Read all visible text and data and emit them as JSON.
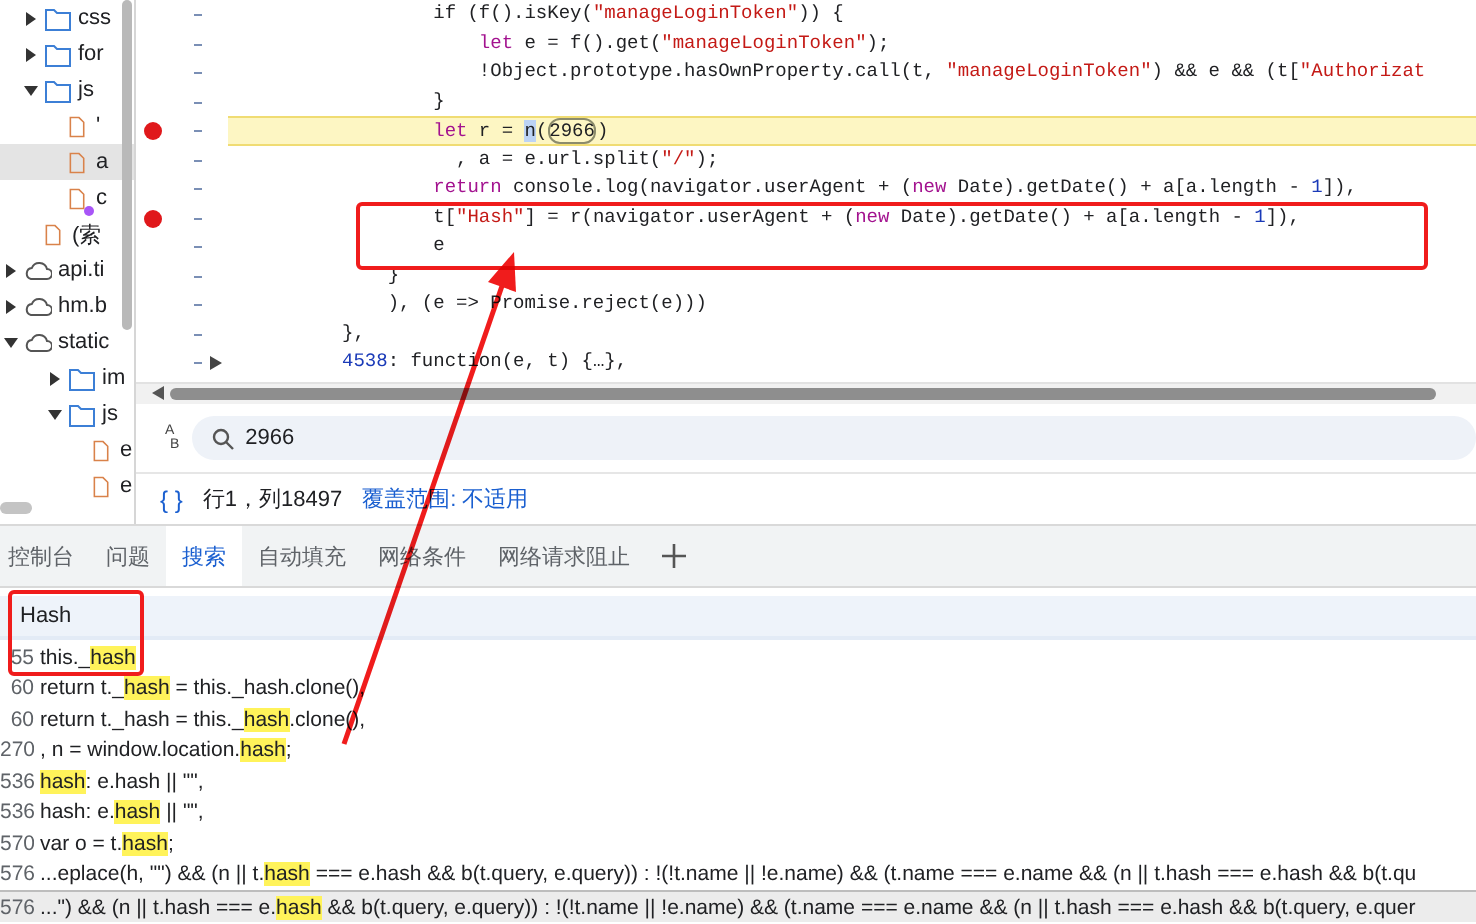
{
  "file_tree": [
    {
      "kind": "folder",
      "label": "css",
      "expanded": false,
      "selected": false
    },
    {
      "kind": "folder",
      "label": "for",
      "expanded": false,
      "selected": false
    },
    {
      "kind": "folder",
      "label": "js",
      "expanded": true,
      "selected": false,
      "children": [
        {
          "kind": "file",
          "label": "'",
          "selected": false,
          "has_dot": false
        },
        {
          "kind": "file",
          "label": "a",
          "selected": true,
          "has_dot": false
        },
        {
          "kind": "file",
          "label": "c",
          "selected": false,
          "has_dot": true
        }
      ]
    },
    {
      "kind": "file",
      "label": "(索",
      "selected": false,
      "has_dot": false
    },
    {
      "kind": "domain",
      "label": "api.ti",
      "expanded": false,
      "selected": false
    },
    {
      "kind": "domain",
      "label": "hm.b",
      "expanded": false,
      "selected": false
    },
    {
      "kind": "domain",
      "label": "static",
      "expanded": true,
      "selected": false,
      "children": [
        {
          "kind": "folder",
          "label": "im",
          "expanded": false,
          "selected": false
        },
        {
          "kind": "folder",
          "label": "js",
          "expanded": true,
          "selected": false,
          "children": [
            {
              "kind": "file",
              "label": "e",
              "selected": false,
              "has_dot": false
            },
            {
              "kind": "file",
              "label": "e",
              "selected": false,
              "has_dot": false
            }
          ]
        }
      ]
    }
  ],
  "code_lines": [
    {
      "breakpoint": false,
      "paused": false,
      "expandable": false,
      "tokens": [
        {
          "kind": "plain",
          "text": "                  if (f().isKey("
        },
        {
          "kind": "str",
          "text": "\"manageLoginToken\""
        },
        {
          "kind": "plain",
          "text": ")) {"
        }
      ]
    },
    {
      "breakpoint": false,
      "paused": false,
      "expandable": false,
      "tokens": [
        {
          "kind": "kw",
          "text": "                      let"
        },
        {
          "kind": "plain",
          "text": " e = f().get("
        },
        {
          "kind": "str",
          "text": "\"manageLoginToken\""
        },
        {
          "kind": "plain",
          "text": ");"
        }
      ]
    },
    {
      "breakpoint": false,
      "paused": false,
      "expandable": false,
      "tokens": [
        {
          "kind": "plain",
          "text": "                      !Object.prototype.hasOwnProperty.call(t, "
        },
        {
          "kind": "str",
          "text": "\"manageLoginToken\""
        },
        {
          "kind": "plain",
          "text": ") && e && (t["
        },
        {
          "kind": "str",
          "text": "\"Authorizat"
        }
      ]
    },
    {
      "breakpoint": false,
      "paused": false,
      "expandable": false,
      "tokens": [
        {
          "kind": "plain",
          "text": "                  }"
        }
      ]
    },
    {
      "breakpoint": true,
      "paused": true,
      "expandable": false,
      "tokens": [
        {
          "kind": "kw",
          "text": "                  let"
        },
        {
          "kind": "plain",
          "text": " r = "
        },
        {
          "kind": "sel",
          "text": "n"
        },
        {
          "kind": "plain",
          "text": "("
        },
        {
          "kind": "box",
          "text": "2966"
        },
        {
          "kind": "plain",
          "text": ")"
        }
      ]
    },
    {
      "breakpoint": false,
      "paused": false,
      "expandable": false,
      "tokens": [
        {
          "kind": "plain",
          "text": "                    , a = e.url.split("
        },
        {
          "kind": "str",
          "text": "\"/\""
        },
        {
          "kind": "plain",
          "text": ");"
        }
      ]
    },
    {
      "breakpoint": false,
      "paused": false,
      "expandable": false,
      "tokens": [
        {
          "kind": "kw",
          "text": "                  return"
        },
        {
          "kind": "plain",
          "text": " console.log(navigator.userAgent + ("
        },
        {
          "kind": "kw",
          "text": "new"
        },
        {
          "kind": "plain",
          "text": " Date).getDate() + a[a.length - "
        },
        {
          "kind": "num",
          "text": "1"
        },
        {
          "kind": "plain",
          "text": "]),"
        }
      ]
    },
    {
      "breakpoint": true,
      "paused": false,
      "expandable": false,
      "tokens": [
        {
          "kind": "plain",
          "text": "                  t["
        },
        {
          "kind": "str",
          "text": "\"Hash\""
        },
        {
          "kind": "plain",
          "text": "] = r(navigator.userAgent + ("
        },
        {
          "kind": "kw",
          "text": "new"
        },
        {
          "kind": "plain",
          "text": " Date).getDate() + a[a.length - "
        },
        {
          "kind": "num",
          "text": "1"
        },
        {
          "kind": "plain",
          "text": "]),"
        }
      ]
    },
    {
      "breakpoint": false,
      "paused": false,
      "expandable": false,
      "tokens": [
        {
          "kind": "plain",
          "text": "                  e"
        }
      ]
    },
    {
      "breakpoint": false,
      "paused": false,
      "expandable": false,
      "tokens": [
        {
          "kind": "plain",
          "text": "              }"
        }
      ]
    },
    {
      "breakpoint": false,
      "paused": false,
      "expandable": false,
      "tokens": [
        {
          "kind": "plain",
          "text": "              ), (e => Promise.reject(e)))"
        }
      ]
    },
    {
      "breakpoint": false,
      "paused": false,
      "expandable": false,
      "tokens": [
        {
          "kind": "plain",
          "text": "          },"
        }
      ]
    },
    {
      "breakpoint": false,
      "paused": false,
      "expandable": true,
      "tokens": [
        {
          "kind": "num",
          "text": "          4538"
        },
        {
          "kind": "plain",
          "text": ": function(e, t) {…},"
        }
      ]
    }
  ],
  "find_bar": {
    "toggle_letters": [
      "A",
      "B"
    ],
    "value": "2966"
  },
  "status_bar": {
    "format_button": "{ }",
    "position": "行1，列18497",
    "coverage": "覆盖范围: 不适用"
  },
  "tabs": [
    {
      "label": "控制台",
      "selected": false
    },
    {
      "label": "问题",
      "selected": false
    },
    {
      "label": "搜索",
      "selected": true
    },
    {
      "label": "自动填充",
      "selected": false
    },
    {
      "label": "网络条件",
      "selected": false
    },
    {
      "label": "网络请求阻止",
      "selected": false
    }
  ],
  "search": {
    "value": "Hash"
  },
  "results": [
    {
      "line": "55",
      "selected": false,
      "parts": [
        {
          "text": "this._",
          "hit": false
        },
        {
          "text": "hash",
          "hit": true
        }
      ]
    },
    {
      "line": "60",
      "selected": false,
      "parts": [
        {
          "text": "return t._",
          "hit": false
        },
        {
          "text": "hash",
          "hit": true
        },
        {
          "text": " = this._hash.clone(),",
          "hit": false
        }
      ]
    },
    {
      "line": "60",
      "selected": false,
      "parts": [
        {
          "text": "return t._hash = this._",
          "hit": false
        },
        {
          "text": "hash",
          "hit": true
        },
        {
          "text": ".clone(),",
          "hit": false
        }
      ]
    },
    {
      "line": "270",
      "selected": false,
      "parts": [
        {
          "text": ", n = window.location.",
          "hit": false
        },
        {
          "text": "hash",
          "hit": true
        },
        {
          "text": ";",
          "hit": false
        }
      ]
    },
    {
      "line": "536",
      "selected": false,
      "parts": [
        {
          "text": "hash",
          "hit": true
        },
        {
          "text": ": e.hash || \"\",",
          "hit": false
        }
      ]
    },
    {
      "line": "536",
      "selected": false,
      "parts": [
        {
          "text": "hash: e.",
          "hit": false
        },
        {
          "text": "hash",
          "hit": true
        },
        {
          "text": " || \"\",",
          "hit": false
        }
      ]
    },
    {
      "line": "570",
      "selected": false,
      "parts": [
        {
          "text": "var o = t.",
          "hit": false
        },
        {
          "text": "hash",
          "hit": true
        },
        {
          "text": ";",
          "hit": false
        }
      ]
    },
    {
      "line": "576",
      "selected": false,
      "parts": [
        {
          "text": "...eplace(h, \"\") && (n || t.",
          "hit": false
        },
        {
          "text": "hash",
          "hit": true
        },
        {
          "text": " === e.hash && b(t.query, e.query)) : !(!t.name || !e.name) && (t.name === e.name && (n || t.hash === e.hash && b(t.qu",
          "hit": false
        }
      ]
    },
    {
      "line": "576",
      "selected": true,
      "parts": [
        {
          "text": "...\") && (n || t.hash === e.",
          "hit": false
        },
        {
          "text": "hash",
          "hit": true
        },
        {
          "text": " && b(t.query, e.query)) : !(!t.name || !e.name) && (t.name === e.name && (n || t.hash === e.hash && b(t.query, e.quer",
          "hit": false
        }
      ]
    }
  ]
}
